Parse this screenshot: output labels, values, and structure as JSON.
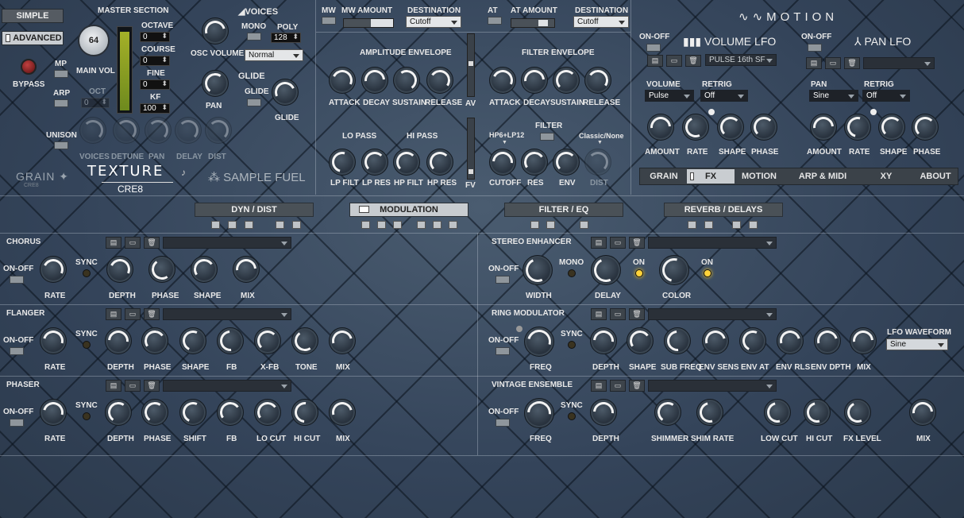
{
  "top_left": {
    "simple": "SIMPLE",
    "advanced": "ADVANCED",
    "bypass": "BYPASS",
    "mp": "MP",
    "arp": "ARP",
    "unison": "UNISON",
    "master_section": "MASTER SECTION",
    "main_vol_value": "64",
    "main_vol": "MAIN VOL",
    "octave": "OCTAVE",
    "octave_val": "0",
    "course": "COURSE",
    "course_val": "0",
    "fine": "FINE",
    "fine_val": "0",
    "kf": "KF",
    "kf_val": "100",
    "oct_dim": "OCT",
    "oct_dim_val": "0",
    "voices": "VOICES",
    "osc_volume": "OSC VOLUME",
    "mono": "MONO",
    "poly": "POLY",
    "poly_val": "128",
    "voice_mode": "Normal",
    "pan": "PAN",
    "glide_header": "GLIDE",
    "glide": "GLIDE",
    "glide_knob": "GLIDE",
    "unison_labels": [
      "VOICES",
      "DETUNE",
      "PAN",
      "DELAY",
      "DIST"
    ],
    "brand_grain": "GRAIN",
    "brand_cre8_small": "CRE8",
    "brand_texture": "TEXTURE",
    "brand_cre8": "CRE8",
    "brand_sample_fuel": "SAMPLE FUEL"
  },
  "mod_bar": {
    "mw": "MW",
    "mw_amount": "MW AMOUNT",
    "destination": "DESTINATION",
    "dest1": "Cutoff",
    "at": "AT",
    "at_amount": "AT AMOUNT",
    "destination2": "DESTINATION",
    "dest2": "Cutoff"
  },
  "amp_env": {
    "title": "AMPLITUDE ENVELOPE",
    "labels": [
      "ATTACK",
      "DECAY",
      "SUSTAIN",
      "RELEASE"
    ],
    "av": "AV"
  },
  "filter_env": {
    "title": "FILTER ENVELOPE",
    "labels": [
      "ATTACK",
      "DECAY",
      "SUSTAIN",
      "RELEASE"
    ]
  },
  "filters": {
    "lo_pass": "LO PASS",
    "hi_pass": "HI PASS",
    "labels_lp": [
      "LP FILT",
      "LP RES"
    ],
    "labels_hp": [
      "HP FILT",
      "HP RES"
    ],
    "fv": "FV",
    "hp_type": "HP6+LP12",
    "filter": "FILTER",
    "classic": "Classic/None",
    "labels2": [
      "CUTOFF",
      "RES",
      "ENV",
      "DIST"
    ]
  },
  "motion": {
    "logo": "MOTION",
    "onoff1": "ON-OFF",
    "volume_lfo": "VOLUME LFO",
    "preset": "PULSE 16th SF",
    "onoff2": "ON-OFF",
    "pan_lfo": "PAN LFO",
    "volume": "VOLUME",
    "retrig": "RETRIG",
    "vol_shape": "Pulse",
    "vol_retrig": "Off",
    "pan": "PAN",
    "retrig2": "RETRIG",
    "pan_shape": "Sine",
    "pan_retrig": "Off",
    "knobs": [
      "AMOUNT",
      "RATE",
      "SHAPE",
      "PHASE"
    ]
  },
  "nav_tabs": [
    "GRAIN",
    "FX",
    "MOTION",
    "ARP & MIDI",
    "XY",
    "ABOUT"
  ],
  "fx_tabs": [
    "DYN / DIST",
    "MODULATION",
    "FILTER / EQ",
    "REVERB / DELAYS"
  ],
  "chorus": {
    "title": "CHORUS",
    "onoff": "ON-OFF",
    "sync": "SYNC",
    "labels": [
      "RATE",
      "DEPTH",
      "PHASE",
      "SHAPE",
      "MIX"
    ]
  },
  "flanger": {
    "title": "FLANGER",
    "onoff": "ON-OFF",
    "sync": "SYNC",
    "labels": [
      "RATE",
      "DEPTH",
      "PHASE",
      "SHAPE",
      "FB",
      "X-FB",
      "TONE",
      "MIX"
    ]
  },
  "phaser": {
    "title": "PHASER",
    "onoff": "ON-OFF",
    "sync": "SYNC",
    "labels": [
      "RATE",
      "DEPTH",
      "PHASE",
      "SHIFT",
      "FB",
      "LO CUT",
      "HI CUT",
      "MIX"
    ]
  },
  "stereo": {
    "title": "STEREO ENHANCER",
    "onoff": "ON-OFF",
    "mono": "MONO",
    "on1": "ON",
    "on2": "ON",
    "labels": [
      "WIDTH",
      "DELAY",
      "COLOR"
    ]
  },
  "ring": {
    "title": "RING MODULATOR",
    "onoff": "ON-OFF",
    "sync": "SYNC",
    "lfo_waveform": "LFO WAVEFORM",
    "waveform": "Sine",
    "labels": [
      "FREQ",
      "DEPTH",
      "SHAPE",
      "SUB FREQ",
      "ENV SENS",
      "ENV AT",
      "ENV RLS",
      "ENV DPTH",
      "MIX"
    ]
  },
  "vintage": {
    "title": "VINTAGE ENSEMBLE",
    "onoff": "ON-OFF",
    "sync": "SYNC",
    "labels": [
      "FREQ",
      "DEPTH",
      "SHIMMER",
      "SHIM RATE",
      "LOW CUT",
      "HI CUT",
      "FX LEVEL",
      "MIX"
    ]
  }
}
